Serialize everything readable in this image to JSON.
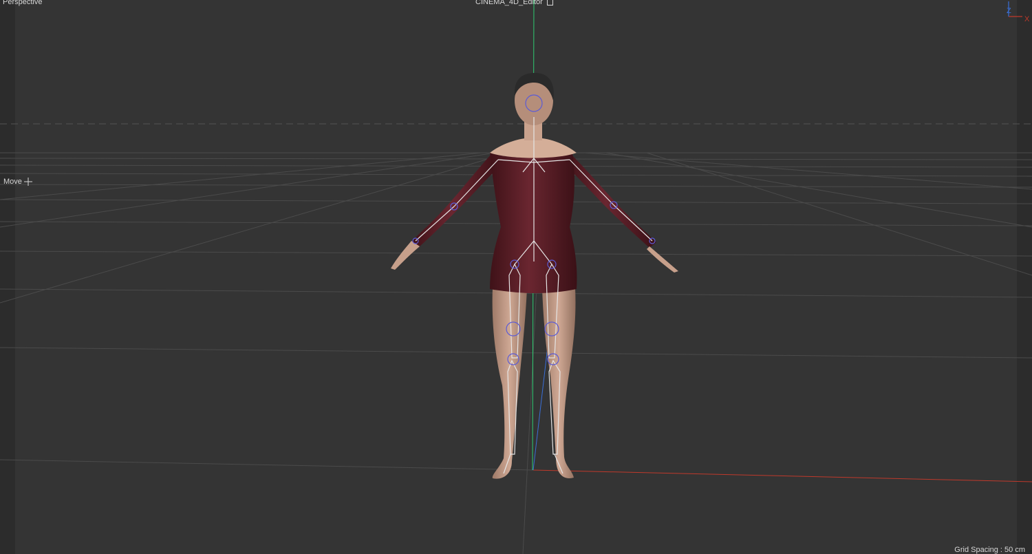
{
  "viewport": {
    "view_name": "Perspective",
    "camera_name": "CINEMA_4D_Editor",
    "camera_icon": "camera-square-icon",
    "tool_name": "Move",
    "tool_icon": "move-crosshair-icon",
    "grid_spacing": "Grid Spacing : 50 cm",
    "axis_labels": {
      "x": "X",
      "z": "Z"
    },
    "colors": {
      "background": "#343434",
      "grid": "#4a4a4a",
      "axis_x": "#c0392b",
      "axis_y": "#2ecc71",
      "axis_z": "#3a6fd8",
      "cloth": "#5a1e26",
      "skin": "#c49b86",
      "bones": "#e6e6e6",
      "joints": "#5b5bd6"
    }
  }
}
